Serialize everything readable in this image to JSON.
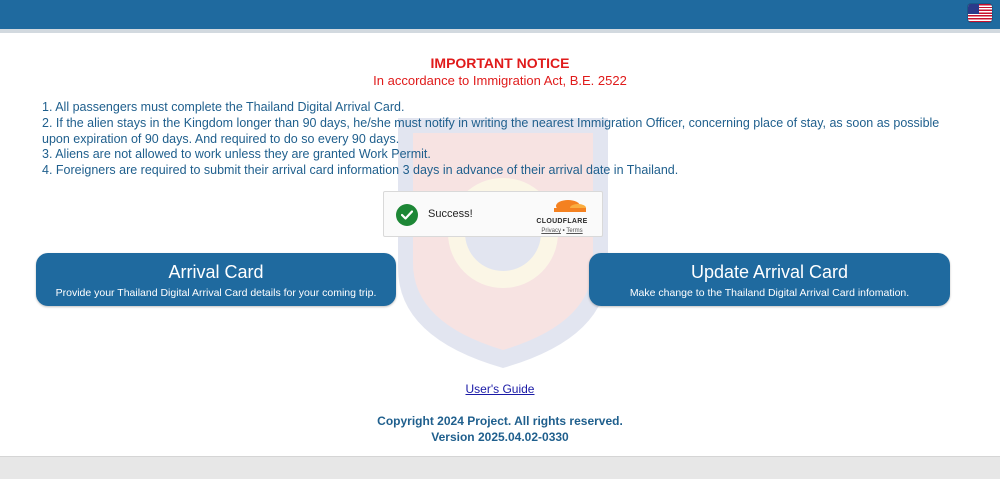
{
  "header": {
    "language_flag_icon": "us-flag-icon",
    "color": "#1f6a9f"
  },
  "notice": {
    "title": "IMPORTANT NOTICE",
    "subtitle": "In accordance to Immigration Act, B.E. 2522",
    "items": [
      "1. All passengers must complete the Thailand Digital Arrival Card.",
      "2. If the alien stays in the Kingdom longer than 90 days, he/she must notify in writing the nearest Immigration Officer, concerning place of stay, as soon as possible upon expiration of 90 days. And required to do so every 90 days.",
      "3. Aliens are not allowed to work unless they are granted Work Permit.",
      "4. Foreigners are required to submit their arrival card information 3 days in advance of their arrival date in Thailand."
    ],
    "color": "#e01b1b"
  },
  "captcha": {
    "status": "Success!",
    "brand": "CLOUDFLARE",
    "privacy": "Privacy",
    "separator": "•",
    "terms": "Terms",
    "icon": "check-circle-icon"
  },
  "buttons": {
    "arrival": {
      "title": "Arrival Card",
      "description": "Provide your Thailand Digital Arrival Card details for your coming trip."
    },
    "update": {
      "title": "Update Arrival Card",
      "description": "Make change to the Thailand Digital Arrival Card infomation."
    }
  },
  "footer": {
    "guide_link": "User's Guide",
    "copyright": "Copyright 2024 Project. All rights reserved.",
    "version": "Version 2025.04.02-0330"
  }
}
